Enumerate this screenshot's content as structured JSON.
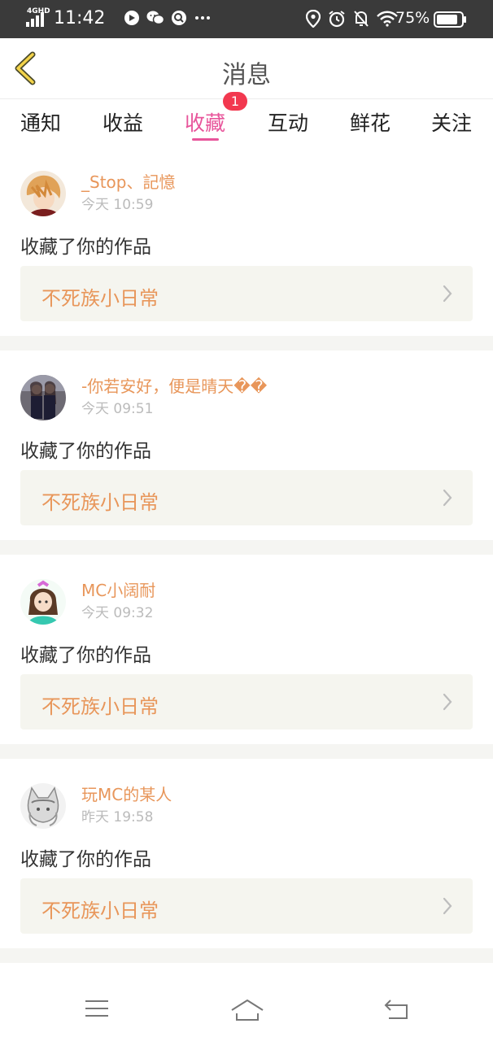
{
  "status_bar": {
    "network": "4GHD",
    "time": "11:42",
    "battery_percent": "75%",
    "icons_left": [
      "chrome-like-icon",
      "wechat-icon",
      "search-app-icon",
      "more-dots-icon"
    ],
    "icons_right": [
      "location-icon",
      "alarm-icon",
      "mute-bell-icon",
      "wifi-icon"
    ]
  },
  "header": {
    "title": "消息"
  },
  "tabs": [
    {
      "label": "通知"
    },
    {
      "label": "收益"
    },
    {
      "label": "收藏",
      "active": true,
      "badge": "1"
    },
    {
      "label": "互动"
    },
    {
      "label": "鲜花"
    },
    {
      "label": "关注"
    }
  ],
  "notifications": [
    {
      "username": "_Stop、記憶",
      "time": "今天 10:59",
      "action": "收藏了你的作品",
      "work": "不死族小日常"
    },
    {
      "username": "-你若安好，便是晴天��",
      "time": "今天 09:51",
      "action": "收藏了你的作品",
      "work": "不死族小日常"
    },
    {
      "username": "MC小阔耐",
      "time": "今天 09:32",
      "action": "收藏了你的作品",
      "work": "不死族小日常"
    },
    {
      "username": "玩MC的某人",
      "time": "昨天 19:58",
      "action": "收藏了你的作品",
      "work": "不死族小日常"
    }
  ],
  "colors": {
    "accent_pink": "#e8559b",
    "username_orange": "#e8965a",
    "badge_red": "#f2384f",
    "status_bar_bg": "#3a3a3a"
  },
  "bottom_nav": [
    "menu-icon",
    "home-icon",
    "back-return-icon"
  ]
}
